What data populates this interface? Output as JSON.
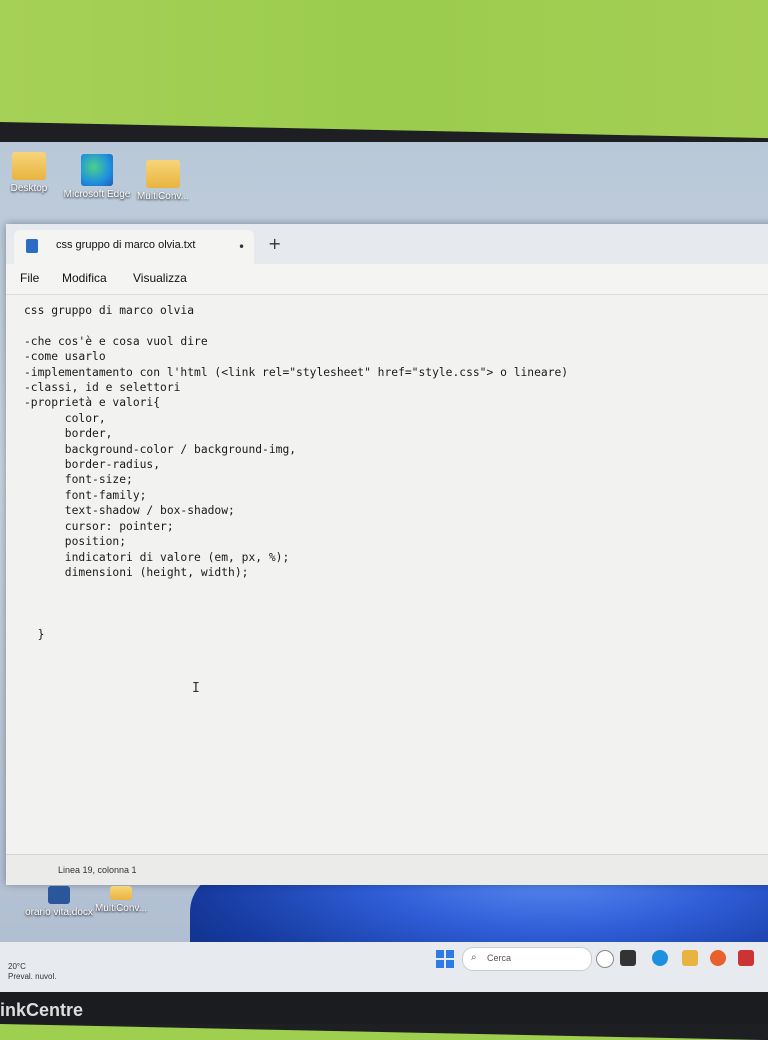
{
  "desktop": {
    "icons": [
      {
        "label": "Desktop"
      },
      {
        "label": "Microsoft Edge"
      },
      {
        "label": "MultiConv..."
      }
    ],
    "bottom_icons": [
      {
        "label": "orario vita.docx"
      },
      {
        "label": "MultiConv..."
      }
    ]
  },
  "notepad": {
    "tab_title": "css gruppo di marco olvia.txt",
    "tab_modified_indicator": "•",
    "new_tab_label": "+",
    "menu": [
      "File",
      "Modifica",
      "Visualizza"
    ],
    "content": "css gruppo di marco olvia\n\n-che cos'è e cosa vuol dire\n-come usarlo\n-implementamento con l'html (<link rel=\"stylesheet\" href=\"style.css\"> o lineare)\n-classi, id e selettori\n-proprietà e valori{\n      color,\n      border,\n      background-color / background-img,\n      border-radius,\n      font-size;\n      font-family;\n      text-shadow / box-shadow;\n      cursor: pointer;\n      position;\n      indicatori di valore (em, px, %);\n      dimensioni (height, width);\n\n\n\n  }",
    "status": "Linea 19, colonna 1"
  },
  "taskbar": {
    "weather_temp": "20°C",
    "weather_desc": "Preval. nuvol.",
    "search_placeholder": "Cerca"
  },
  "monitor_brand": "inkCentre",
  "colors": {
    "wall": "#9fcf4e",
    "bezel": "#1d1f22",
    "accent": "#2e7be3"
  }
}
